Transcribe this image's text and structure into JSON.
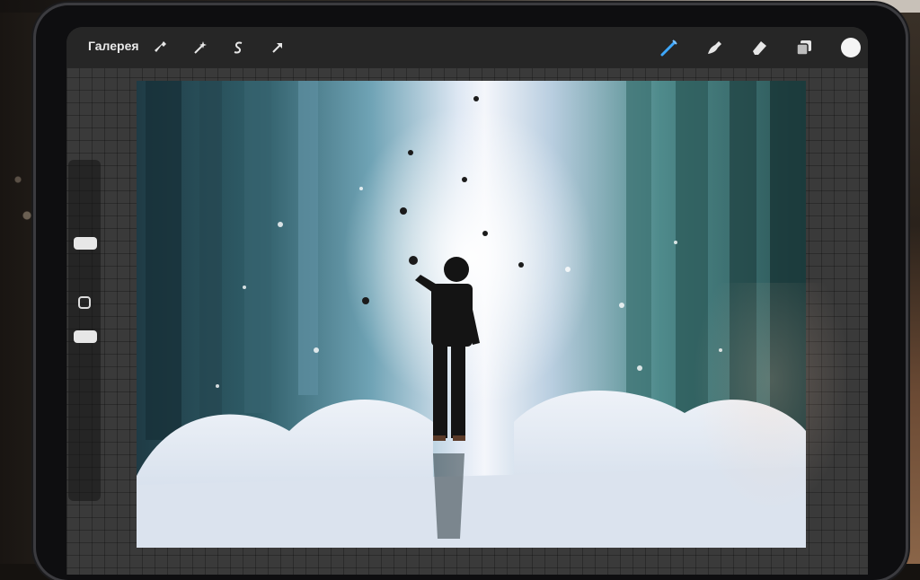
{
  "toolbar": {
    "gallery_label": "Галерея",
    "left_tools": [
      {
        "icon": "wrench-icon"
      },
      {
        "icon": "magic-wand-icon"
      },
      {
        "icon": "selection-s-icon"
      },
      {
        "icon": "transform-arrow-icon"
      }
    ],
    "right_tools": [
      {
        "icon": "brush-icon"
      },
      {
        "icon": "smudge-icon"
      },
      {
        "icon": "eraser-icon"
      },
      {
        "icon": "layers-icon"
      }
    ],
    "current_color": "#f4f4f4"
  },
  "sidebar": {
    "items": [
      {
        "name": "brush-size-slider"
      },
      {
        "name": "modify-button"
      },
      {
        "name": "opacity-slider"
      }
    ]
  },
  "canvas": {
    "subject": "artwork-canvas"
  }
}
